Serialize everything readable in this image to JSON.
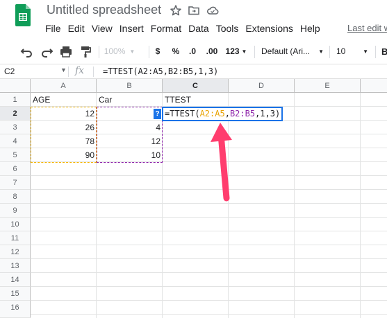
{
  "app": {
    "title": "Untitled spreadsheet",
    "last_edit": "Last edit w",
    "menus": [
      "File",
      "Edit",
      "View",
      "Insert",
      "Format",
      "Data",
      "Tools",
      "Extensions",
      "Help"
    ]
  },
  "toolbar": {
    "zoom": "100%",
    "currency": "$",
    "percent": "%",
    "decrease_decimal": ".0",
    "increase_decimal": ".00",
    "more_formats": "123",
    "font": "Default (Ari...",
    "font_size": "10",
    "bold": "B"
  },
  "formula_bar": {
    "cell_ref": "C2",
    "fx": "fx",
    "formula": "=TTEST(A2:A5,B2:B5,1,3)"
  },
  "grid": {
    "columns": [
      "A",
      "B",
      "C",
      "D",
      "E"
    ],
    "rows": [
      "1",
      "2",
      "3",
      "4",
      "5",
      "6",
      "7",
      "8",
      "9",
      "10",
      "11",
      "12",
      "13",
      "14",
      "15",
      "16"
    ],
    "active_cell": "C2",
    "cells": {
      "A1": "AGE",
      "B1": "Car",
      "C1": "TTEST",
      "A2": "12",
      "A3": "26",
      "A4": "78",
      "A5": "90",
      "B3": "4",
      "B4": "12",
      "B5": "10"
    }
  },
  "editor": {
    "prefix": "=TTEST(",
    "range_a": "A2:A5",
    "comma1": ",",
    "range_b": "B2:B5",
    "rest": ",1,3)",
    "help": "?"
  },
  "colors": {
    "accent": "#1a73e8",
    "range_a": "#f4b400",
    "range_b": "#8e24aa",
    "annotation_arrow": "#ff3d6e"
  },
  "icons": {
    "star": "star-icon",
    "move": "folder-move-icon",
    "cloud": "cloud-status-icon",
    "undo": "undo-icon",
    "redo": "redo-icon",
    "print": "print-icon",
    "paint": "paint-format-icon"
  }
}
